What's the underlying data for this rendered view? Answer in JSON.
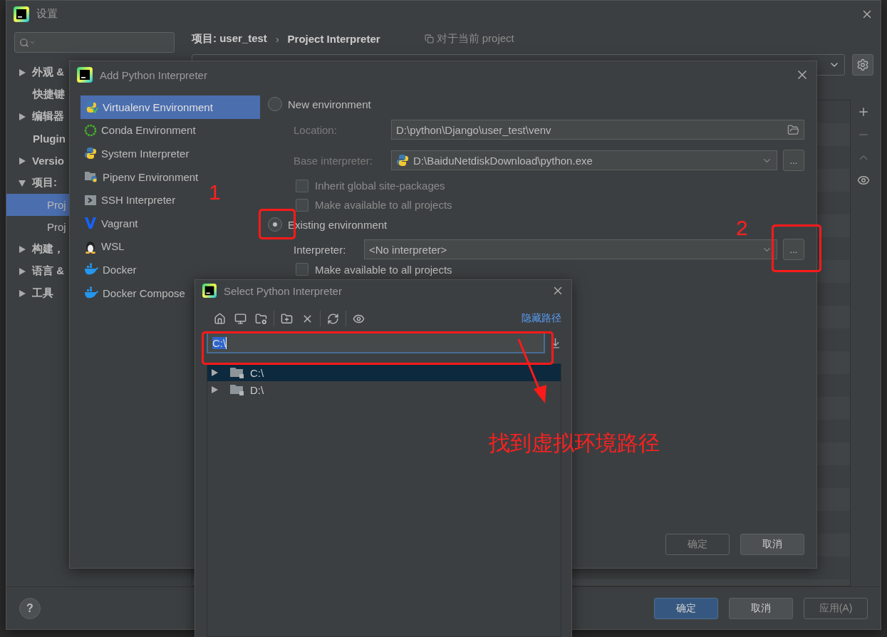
{
  "settings": {
    "title": "设置",
    "sidebar": {
      "items": [
        {
          "label": "外观 &",
          "kind": "group",
          "expanded": false,
          "selected": false
        },
        {
          "label": "快捷键",
          "kind": "page",
          "selected": false
        },
        {
          "label": "编辑器",
          "kind": "group",
          "expanded": false,
          "selected": false
        },
        {
          "label": "Plugin",
          "kind": "page",
          "selected": false
        },
        {
          "label": "Versio",
          "kind": "group",
          "expanded": false,
          "selected": false
        },
        {
          "label": "项目:",
          "kind": "group",
          "expanded": true,
          "selected": false,
          "children": [
            {
              "label": "Proj",
              "selected": true
            },
            {
              "label": "Proj",
              "selected": false
            }
          ]
        },
        {
          "label": "构建，",
          "kind": "group",
          "expanded": false,
          "selected": false
        },
        {
          "label": "语言 &",
          "kind": "group",
          "expanded": false,
          "selected": false
        },
        {
          "label": "工具",
          "kind": "group",
          "expanded": false,
          "selected": false
        }
      ]
    },
    "breadcrumb": {
      "parts": [
        "项目: user_test",
        "Project Interpreter"
      ],
      "separator": "›",
      "scope_note": "对于当前 project"
    },
    "help_button": "?",
    "buttons": [
      {
        "label": "确定",
        "kind": "primary",
        "disabled": false
      },
      {
        "label": "取消",
        "kind": "normal",
        "disabled": false
      },
      {
        "label": "应用(A)",
        "kind": "normal",
        "disabled": true
      }
    ]
  },
  "add_dialog": {
    "title": "Add Python Interpreter",
    "environments": [
      {
        "label": "Virtualenv Environment",
        "kind": "virtualenv",
        "selected": true
      },
      {
        "label": "Conda Environment",
        "kind": "conda",
        "selected": false
      },
      {
        "label": "System Interpreter",
        "kind": "python",
        "selected": false
      },
      {
        "label": "Pipenv Environment",
        "kind": "pipenv",
        "selected": false
      },
      {
        "label": "SSH Interpreter",
        "kind": "ssh",
        "selected": false
      },
      {
        "label": "Vagrant",
        "kind": "vagrant",
        "selected": false
      },
      {
        "label": "WSL",
        "kind": "wsl",
        "selected": false
      },
      {
        "label": "Docker",
        "kind": "docker",
        "selected": false
      },
      {
        "label": "Docker Compose",
        "kind": "docker",
        "selected": false
      }
    ],
    "new_environment": {
      "label": "New environment",
      "selected": false,
      "location": {
        "label": "Location:",
        "value": "D:\\python\\Django\\user_test\\venv"
      },
      "base_interpreter": {
        "label": "Base interpreter:",
        "value": "D:\\BaiduNetdiskDownload\\python.exe",
        "button": "..."
      },
      "checkboxes": [
        {
          "label": "Inherit global site-packages",
          "checked": false
        },
        {
          "label": "Make available to all projects",
          "checked": false
        }
      ]
    },
    "existing_environment": {
      "label": "Existing environment",
      "selected": true,
      "interpreter": {
        "label": "Interpreter:",
        "value": "<No interpreter>",
        "button": "..."
      },
      "checkboxes": [
        {
          "label": "Make available to all projects",
          "checked": false
        }
      ]
    },
    "buttons": [
      {
        "label": "确定",
        "disabled": true
      },
      {
        "label": "取消",
        "disabled": false
      }
    ]
  },
  "select_dialog": {
    "title": "Select Python Interpreter",
    "link": "隐藏路径",
    "path": "C:\\",
    "tree": [
      {
        "label": "C:\\",
        "selected": true,
        "expanded": false
      },
      {
        "label": "D:\\",
        "selected": false,
        "expanded": false
      }
    ]
  },
  "annotations": {
    "markers": [
      "1",
      "2"
    ],
    "note": "找到虚拟环境路径"
  }
}
